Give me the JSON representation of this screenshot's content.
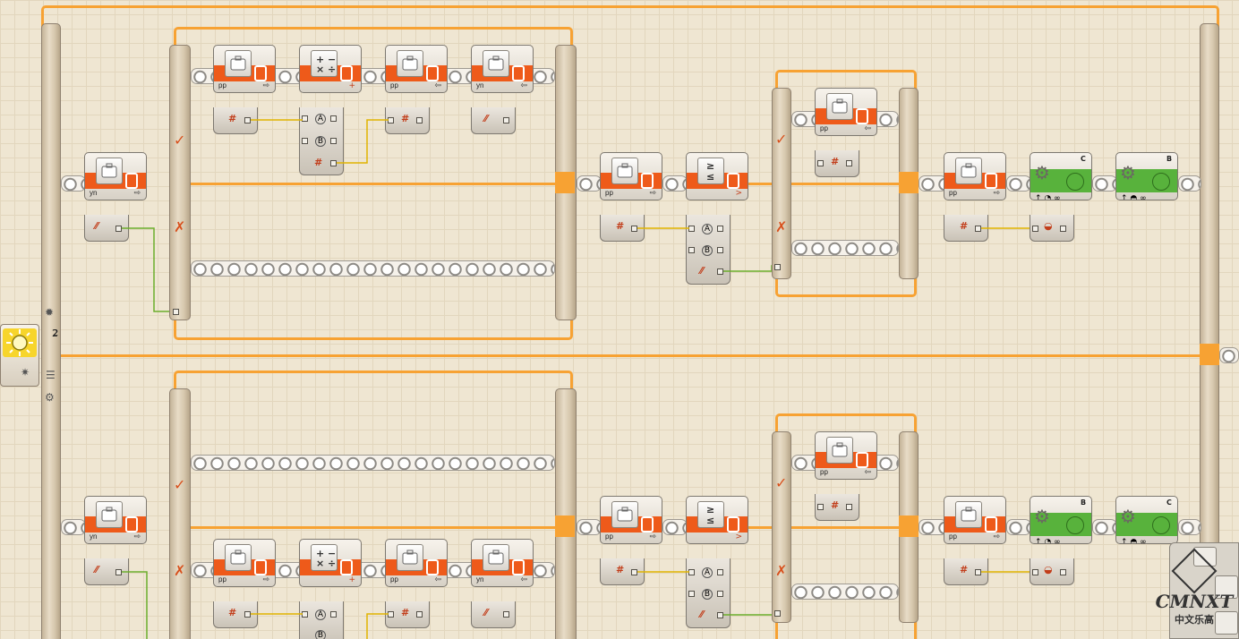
{
  "canvas": {
    "grid_color": "#e2d6bd",
    "background": "#efe6d2",
    "wire_orange": "#f7a233",
    "wire_yellow": "#e0b400",
    "wire_green": "#6cae2c",
    "block_orange": "#ee5a1a",
    "block_green": "#58b23c"
  },
  "loop_top": {
    "variable_read_1": {
      "label": "yn"
    },
    "switch_branch_true": [
      {
        "label": "pp",
        "kind": "variable",
        "icon": "briefcase-icon"
      },
      {
        "label": "",
        "kind": "math",
        "icon": "math-icon"
      },
      {
        "label": "pp",
        "kind": "variable",
        "icon": "briefcase-icon"
      },
      {
        "label": "yn",
        "kind": "variable",
        "icon": "briefcase-icon"
      }
    ],
    "variable_read_2": {
      "label": "pp"
    },
    "compare": {
      "symbols": [
        "≥",
        "≤"
      ],
      "result": ">"
    },
    "inner_branch": {
      "label": "pp"
    },
    "variable_read_3": {
      "label": "pp"
    },
    "motor_1": {
      "port": "C"
    },
    "motor_2": {
      "port": "B"
    }
  },
  "loop_bottom": {
    "variable_read_1": {
      "label": "yn"
    },
    "switch_branch_false": [
      {
        "label": "pp",
        "kind": "variable",
        "icon": "briefcase-icon"
      },
      {
        "label": "",
        "kind": "math",
        "icon": "math-icon"
      },
      {
        "label": "pp",
        "kind": "variable",
        "icon": "briefcase-icon"
      },
      {
        "label": "yn",
        "kind": "variable",
        "icon": "briefcase-icon"
      }
    ],
    "variable_read_2": {
      "label": "pp"
    },
    "compare": {
      "symbols": [
        "≥",
        "≤"
      ],
      "result": ">"
    },
    "inner_branch": {
      "label": "pp"
    },
    "variable_read_3": {
      "label": "pp"
    },
    "motor_1": {
      "port": "B"
    },
    "motor_2": {
      "port": "C"
    }
  },
  "light_sensor_switch": {
    "port": "2"
  },
  "watermark": {
    "brand": "CMNXT",
    "subtitle": "中文乐高"
  }
}
